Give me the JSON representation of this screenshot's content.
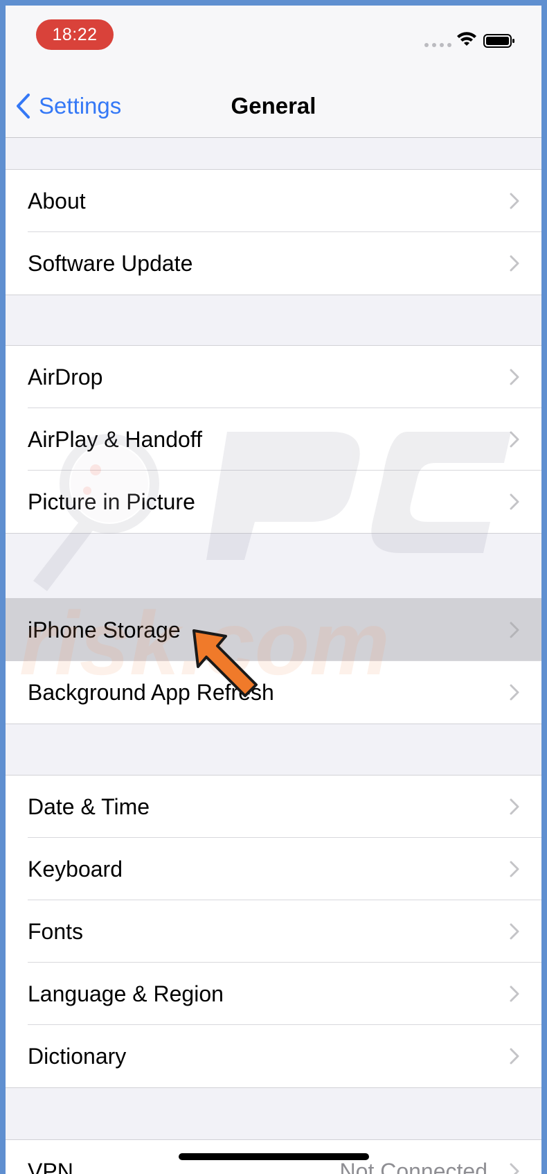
{
  "status_bar": {
    "time": "18:22",
    "icons": [
      "cellular-signal-icon",
      "wifi-icon",
      "battery-icon"
    ],
    "time_pill_color": "#d9423a"
  },
  "nav": {
    "back_label": "Settings",
    "title": "General",
    "accent_color": "#3478f6"
  },
  "groups": [
    {
      "rows": [
        {
          "label": "About"
        },
        {
          "label": "Software Update"
        }
      ]
    },
    {
      "rows": [
        {
          "label": "AirDrop"
        },
        {
          "label": "AirPlay & Handoff"
        },
        {
          "label": "Picture in Picture"
        }
      ]
    },
    {
      "rows": [
        {
          "label": "iPhone Storage",
          "highlighted": true
        },
        {
          "label": "Background App Refresh"
        }
      ]
    },
    {
      "rows": [
        {
          "label": "Date & Time"
        },
        {
          "label": "Keyboard"
        },
        {
          "label": "Fonts"
        },
        {
          "label": "Language & Region"
        },
        {
          "label": "Dictionary"
        }
      ]
    },
    {
      "rows": [
        {
          "label": "VPN",
          "value": "Not Connected"
        }
      ]
    }
  ],
  "annotation": {
    "icon": "pointer-arrow-icon",
    "color": "#f07a2a",
    "points_to": "iPhone Storage"
  },
  "watermark": {
    "text": "risk.com",
    "logo": "PC"
  }
}
